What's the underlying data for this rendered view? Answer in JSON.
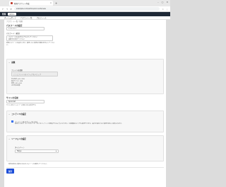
{
  "browser": {
    "tab_title": "新規アカウント作成",
    "tab_close": "×",
    "new_tab": "+",
    "url": "example.com/admin/accounts/new",
    "back": "←",
    "forward": "→",
    "reload": "⟳",
    "win_min": "–",
    "win_max": "▢",
    "win_close": "✕",
    "ext": "☆",
    "menu": "⋮"
  },
  "header": {
    "app_name": "管理",
    "chip_label": "Admin",
    "user_icon": "●"
  },
  "subnav": {
    "links": [
      "ダッシュボード",
      "アカウント一覧",
      "プロフィール"
    ]
  },
  "breadcrumb": "アカウント一覧 / 新規",
  "password": {
    "title": "パスワードの設定",
    "value": "••••••••",
    "mini_label": "パスワード（確認）",
    "hint_lines": [
      "パスワードは8文字以上で入力してください",
      "英数字を含めてください"
    ],
    "note": "新規パスワードを設定します。変更しない場合は空欄のままにしてください。"
  },
  "file_panel": {
    "title": "画像",
    "field_label": "ファイルを選択",
    "drop_text": "ここにファイルをドラッグ＆ドロップ",
    "info_lines": [
      "対応形式: JPG, PNG",
      "最大サイズ: 2MB",
      "推奨: 400×400",
      "正方形の画像"
    ]
  },
  "site_name": {
    "title": "サイトの名前",
    "value": "Sprocket",
    "note": "サイトのタイトルバーに表示される名前です。"
  },
  "options_panel": {
    "title": "コンテンツの設定",
    "check_label": "コンテンツをパブリックにする",
    "check_mark": "✓",
    "desc": "有効にすると、すべてのユーザーがこのコンテンツを閲覧できるようになります。公開範囲はいつでも変更できます。設定を保存すると変更が直ちに反映されます。"
  },
  "region_panel": {
    "title": "リージョンの設定",
    "sub_label": "タイムゾーン",
    "select_value": "Tokyo",
    "select_arrow": "▾",
    "note": "時刻の表示に使用されるタイムゾーンを選択してください。"
  },
  "actions": {
    "save": "保存"
  }
}
